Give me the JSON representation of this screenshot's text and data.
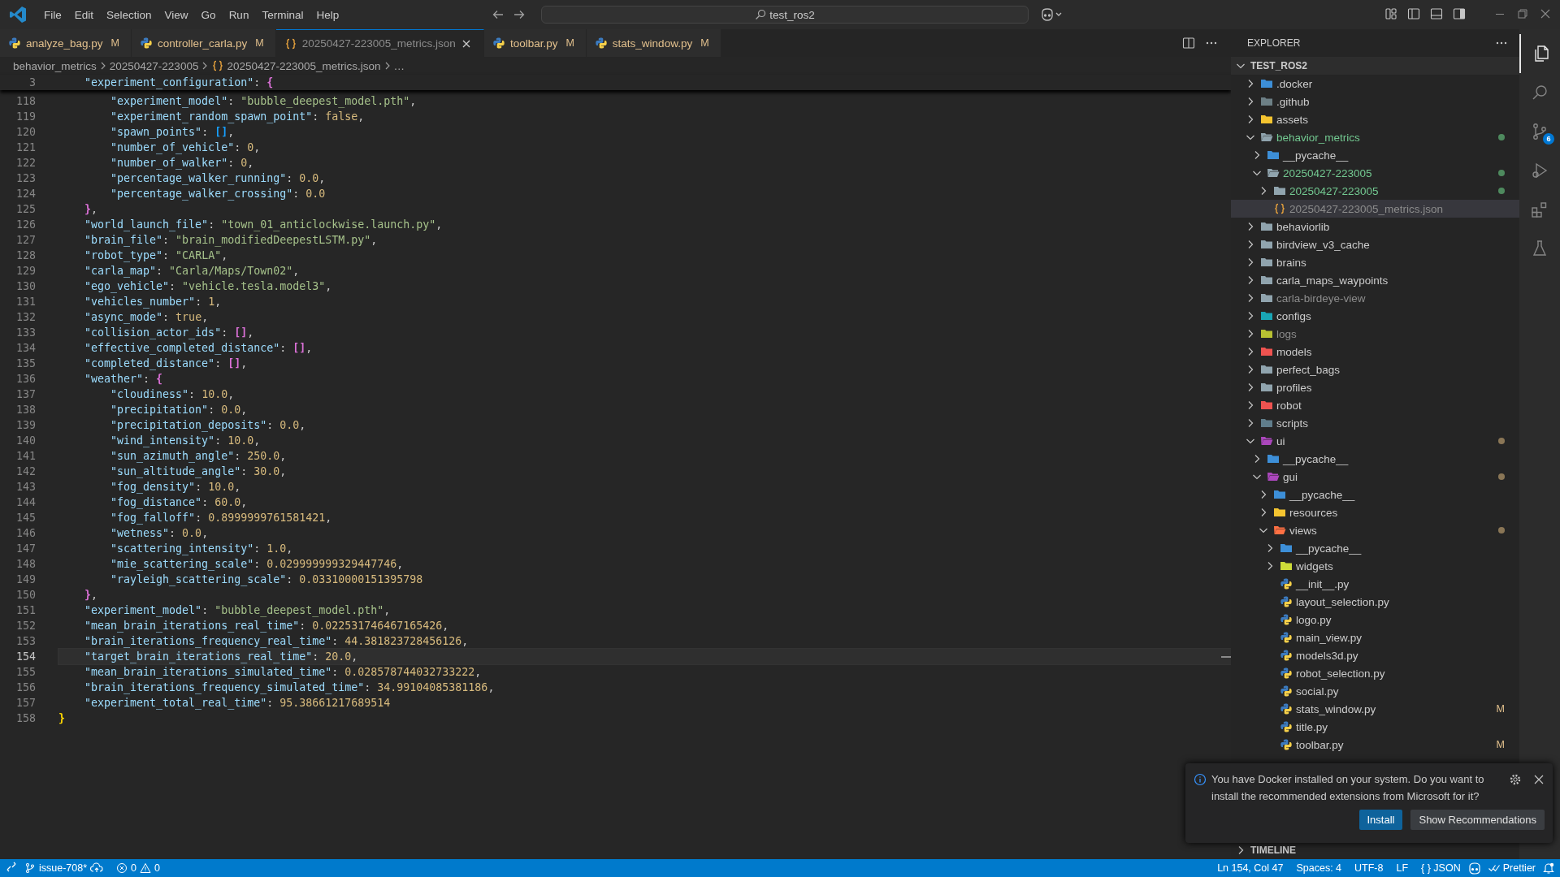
{
  "title_bar": {
    "menu": [
      "File",
      "Edit",
      "Selection",
      "View",
      "Go",
      "Run",
      "Terminal",
      "Help"
    ],
    "search": "test_ros2"
  },
  "tabs": [
    {
      "label": "analyze_bag.py",
      "kind": "python",
      "badge": "M",
      "modified": true,
      "ignored": false,
      "selected": false
    },
    {
      "label": "controller_carla.py",
      "kind": "python",
      "badge": "M",
      "modified": true,
      "ignored": false,
      "selected": false
    },
    {
      "label": "20250427-223005_metrics.json",
      "kind": "json",
      "modified": false,
      "ignored": true,
      "selected": true
    },
    {
      "label": "toolbar.py",
      "kind": "python",
      "badge": "M",
      "modified": true,
      "ignored": false,
      "selected": false
    },
    {
      "label": "stats_window.py",
      "kind": "python",
      "badge": "M",
      "modified": true,
      "ignored": false,
      "selected": false
    }
  ],
  "breadcrumbs": [
    {
      "label": "behavior_metrics",
      "kind": "folder"
    },
    {
      "label": "20250427-223005",
      "kind": "folder"
    },
    {
      "label": "20250427-223005_metrics.json",
      "kind": "json"
    },
    {
      "label": "…",
      "kind": "more"
    }
  ],
  "editor": {
    "sticky_line": {
      "number": "3",
      "tokens": [
        {
          "kind": "key",
          "text": "    \"experiment_configuration\""
        },
        {
          "kind": "punct",
          "text": ": "
        },
        {
          "kind": "bracket",
          "text": "{",
          "color": "#da70d6"
        }
      ]
    },
    "lines": [
      {
        "number": "118",
        "current": false,
        "tokens": [
          {
            "kind": "key",
            "text": "        \"experiment_model\""
          },
          {
            "kind": "punct",
            "text": ": "
          },
          {
            "kind": "string",
            "text": "\"bubble_deepest_model.pth\""
          },
          {
            "kind": "punct",
            "text": ","
          }
        ]
      },
      {
        "number": "119",
        "current": false,
        "tokens": [
          {
            "kind": "key",
            "text": "        \"experiment_random_spawn_point\""
          },
          {
            "kind": "punct",
            "text": ": "
          },
          {
            "kind": "literal",
            "text": "false"
          },
          {
            "kind": "punct",
            "text": ","
          }
        ]
      },
      {
        "number": "120",
        "current": false,
        "tokens": [
          {
            "kind": "key",
            "text": "        \"spawn_points\""
          },
          {
            "kind": "punct",
            "text": ": "
          },
          {
            "kind": "bracket",
            "text": "[]",
            "color": "#179fff"
          },
          {
            "kind": "punct",
            "text": ","
          }
        ]
      },
      {
        "number": "121",
        "current": false,
        "tokens": [
          {
            "kind": "key",
            "text": "        \"number_of_vehicle\""
          },
          {
            "kind": "punct",
            "text": ": "
          },
          {
            "kind": "number",
            "text": "0"
          },
          {
            "kind": "punct",
            "text": ","
          }
        ]
      },
      {
        "number": "122",
        "current": false,
        "tokens": [
          {
            "kind": "key",
            "text": "        \"number_of_walker\""
          },
          {
            "kind": "punct",
            "text": ": "
          },
          {
            "kind": "number",
            "text": "0"
          },
          {
            "kind": "punct",
            "text": ","
          }
        ]
      },
      {
        "number": "123",
        "current": false,
        "tokens": [
          {
            "kind": "key",
            "text": "        \"percentage_walker_running\""
          },
          {
            "kind": "punct",
            "text": ": "
          },
          {
            "kind": "number",
            "text": "0.0"
          },
          {
            "kind": "punct",
            "text": ","
          }
        ]
      },
      {
        "number": "124",
        "current": false,
        "tokens": [
          {
            "kind": "key",
            "text": "        \"percentage_walker_crossing\""
          },
          {
            "kind": "punct",
            "text": ": "
          },
          {
            "kind": "number",
            "text": "0.0"
          }
        ]
      },
      {
        "number": "125",
        "current": false,
        "tokens": [
          {
            "kind": "bracket",
            "text": "    }",
            "color": "#da70d6"
          },
          {
            "kind": "punct",
            "text": ","
          }
        ]
      },
      {
        "number": "126",
        "current": false,
        "tokens": [
          {
            "kind": "key",
            "text": "    \"world_launch_file\""
          },
          {
            "kind": "punct",
            "text": ": "
          },
          {
            "kind": "string",
            "text": "\"town_01_anticlockwise.launch.py\""
          },
          {
            "kind": "punct",
            "text": ","
          }
        ]
      },
      {
        "number": "127",
        "current": false,
        "tokens": [
          {
            "kind": "key",
            "text": "    \"brain_file\""
          },
          {
            "kind": "punct",
            "text": ": "
          },
          {
            "kind": "string",
            "text": "\"brain_modifiedDeepestLSTM.py\""
          },
          {
            "kind": "punct",
            "text": ","
          }
        ]
      },
      {
        "number": "128",
        "current": false,
        "tokens": [
          {
            "kind": "key",
            "text": "    \"robot_type\""
          },
          {
            "kind": "punct",
            "text": ": "
          },
          {
            "kind": "string",
            "text": "\"CARLA\""
          },
          {
            "kind": "punct",
            "text": ","
          }
        ]
      },
      {
        "number": "129",
        "current": false,
        "tokens": [
          {
            "kind": "key",
            "text": "    \"carla_map\""
          },
          {
            "kind": "punct",
            "text": ": "
          },
          {
            "kind": "string",
            "text": "\"Carla/Maps/Town02\""
          },
          {
            "kind": "punct",
            "text": ","
          }
        ]
      },
      {
        "number": "130",
        "current": false,
        "tokens": [
          {
            "kind": "key",
            "text": "    \"ego_vehicle\""
          },
          {
            "kind": "punct",
            "text": ": "
          },
          {
            "kind": "string",
            "text": "\"vehicle.tesla.model3\""
          },
          {
            "kind": "punct",
            "text": ","
          }
        ]
      },
      {
        "number": "131",
        "current": false,
        "tokens": [
          {
            "kind": "key",
            "text": "    \"vehicles_number\""
          },
          {
            "kind": "punct",
            "text": ": "
          },
          {
            "kind": "number",
            "text": "1"
          },
          {
            "kind": "punct",
            "text": ","
          }
        ]
      },
      {
        "number": "132",
        "current": false,
        "tokens": [
          {
            "kind": "key",
            "text": "    \"async_mode\""
          },
          {
            "kind": "punct",
            "text": ": "
          },
          {
            "kind": "literal",
            "text": "true"
          },
          {
            "kind": "punct",
            "text": ","
          }
        ]
      },
      {
        "number": "133",
        "current": false,
        "tokens": [
          {
            "kind": "key",
            "text": "    \"collision_actor_ids\""
          },
          {
            "kind": "punct",
            "text": ": "
          },
          {
            "kind": "bracket",
            "text": "[]",
            "color": "#da70d6"
          },
          {
            "kind": "punct",
            "text": ","
          }
        ]
      },
      {
        "number": "134",
        "current": false,
        "tokens": [
          {
            "kind": "key",
            "text": "    \"effective_completed_distance\""
          },
          {
            "kind": "punct",
            "text": ": "
          },
          {
            "kind": "bracket",
            "text": "[]",
            "color": "#da70d6"
          },
          {
            "kind": "punct",
            "text": ","
          }
        ]
      },
      {
        "number": "135",
        "current": false,
        "tokens": [
          {
            "kind": "key",
            "text": "    \"completed_distance\""
          },
          {
            "kind": "punct",
            "text": ": "
          },
          {
            "kind": "bracket",
            "text": "[]",
            "color": "#da70d6"
          },
          {
            "kind": "punct",
            "text": ","
          }
        ]
      },
      {
        "number": "136",
        "current": false,
        "tokens": [
          {
            "kind": "key",
            "text": "    \"weather\""
          },
          {
            "kind": "punct",
            "text": ": "
          },
          {
            "kind": "bracket",
            "text": "{",
            "color": "#da70d6"
          }
        ]
      },
      {
        "number": "137",
        "current": false,
        "tokens": [
          {
            "kind": "key",
            "text": "        \"cloudiness\""
          },
          {
            "kind": "punct",
            "text": ": "
          },
          {
            "kind": "number",
            "text": "10.0"
          },
          {
            "kind": "punct",
            "text": ","
          }
        ]
      },
      {
        "number": "138",
        "current": false,
        "tokens": [
          {
            "kind": "key",
            "text": "        \"precipitation\""
          },
          {
            "kind": "punct",
            "text": ": "
          },
          {
            "kind": "number",
            "text": "0.0"
          },
          {
            "kind": "punct",
            "text": ","
          }
        ]
      },
      {
        "number": "139",
        "current": false,
        "tokens": [
          {
            "kind": "key",
            "text": "        \"precipitation_deposits\""
          },
          {
            "kind": "punct",
            "text": ": "
          },
          {
            "kind": "number",
            "text": "0.0"
          },
          {
            "kind": "punct",
            "text": ","
          }
        ]
      },
      {
        "number": "140",
        "current": false,
        "tokens": [
          {
            "kind": "key",
            "text": "        \"wind_intensity\""
          },
          {
            "kind": "punct",
            "text": ": "
          },
          {
            "kind": "number",
            "text": "10.0"
          },
          {
            "kind": "punct",
            "text": ","
          }
        ]
      },
      {
        "number": "141",
        "current": false,
        "tokens": [
          {
            "kind": "key",
            "text": "        \"sun_azimuth_angle\""
          },
          {
            "kind": "punct",
            "text": ": "
          },
          {
            "kind": "number",
            "text": "250.0"
          },
          {
            "kind": "punct",
            "text": ","
          }
        ]
      },
      {
        "number": "142",
        "current": false,
        "tokens": [
          {
            "kind": "key",
            "text": "        \"sun_altitude_angle\""
          },
          {
            "kind": "punct",
            "text": ": "
          },
          {
            "kind": "number",
            "text": "30.0"
          },
          {
            "kind": "punct",
            "text": ","
          }
        ]
      },
      {
        "number": "143",
        "current": false,
        "tokens": [
          {
            "kind": "key",
            "text": "        \"fog_density\""
          },
          {
            "kind": "punct",
            "text": ": "
          },
          {
            "kind": "number",
            "text": "10.0"
          },
          {
            "kind": "punct",
            "text": ","
          }
        ]
      },
      {
        "number": "144",
        "current": false,
        "tokens": [
          {
            "kind": "key",
            "text": "        \"fog_distance\""
          },
          {
            "kind": "punct",
            "text": ": "
          },
          {
            "kind": "number",
            "text": "60.0"
          },
          {
            "kind": "punct",
            "text": ","
          }
        ]
      },
      {
        "number": "145",
        "current": false,
        "tokens": [
          {
            "kind": "key",
            "text": "        \"fog_falloff\""
          },
          {
            "kind": "punct",
            "text": ": "
          },
          {
            "kind": "number",
            "text": "0.8999999761581421"
          },
          {
            "kind": "punct",
            "text": ","
          }
        ]
      },
      {
        "number": "146",
        "current": false,
        "tokens": [
          {
            "kind": "key",
            "text": "        \"wetness\""
          },
          {
            "kind": "punct",
            "text": ": "
          },
          {
            "kind": "number",
            "text": "0.0"
          },
          {
            "kind": "punct",
            "text": ","
          }
        ]
      },
      {
        "number": "147",
        "current": false,
        "tokens": [
          {
            "kind": "key",
            "text": "        \"scattering_intensity\""
          },
          {
            "kind": "punct",
            "text": ": "
          },
          {
            "kind": "number",
            "text": "1.0"
          },
          {
            "kind": "punct",
            "text": ","
          }
        ]
      },
      {
        "number": "148",
        "current": false,
        "tokens": [
          {
            "kind": "key",
            "text": "        \"mie_scattering_scale\""
          },
          {
            "kind": "punct",
            "text": ": "
          },
          {
            "kind": "number",
            "text": "0.029999999329447746"
          },
          {
            "kind": "punct",
            "text": ","
          }
        ]
      },
      {
        "number": "149",
        "current": false,
        "tokens": [
          {
            "kind": "key",
            "text": "        \"rayleigh_scattering_scale\""
          },
          {
            "kind": "punct",
            "text": ": "
          },
          {
            "kind": "number",
            "text": "0.03310000151395798"
          }
        ]
      },
      {
        "number": "150",
        "current": false,
        "tokens": [
          {
            "kind": "bracket",
            "text": "    }",
            "color": "#da70d6"
          },
          {
            "kind": "punct",
            "text": ","
          }
        ]
      },
      {
        "number": "151",
        "current": false,
        "tokens": [
          {
            "kind": "key",
            "text": "    \"experiment_model\""
          },
          {
            "kind": "punct",
            "text": ": "
          },
          {
            "kind": "string",
            "text": "\"bubble_deepest_model.pth\""
          },
          {
            "kind": "punct",
            "text": ","
          }
        ]
      },
      {
        "number": "152",
        "current": false,
        "tokens": [
          {
            "kind": "key",
            "text": "    \"mean_brain_iterations_real_time\""
          },
          {
            "kind": "punct",
            "text": ": "
          },
          {
            "kind": "number",
            "text": "0.022531746467165426"
          },
          {
            "kind": "punct",
            "text": ","
          }
        ]
      },
      {
        "number": "153",
        "current": false,
        "tokens": [
          {
            "kind": "key",
            "text": "    \"brain_iterations_frequency_real_time\""
          },
          {
            "kind": "punct",
            "text": ": "
          },
          {
            "kind": "number",
            "text": "44.381823728456126"
          },
          {
            "kind": "punct",
            "text": ","
          }
        ]
      },
      {
        "number": "154",
        "current": true,
        "tokens": [
          {
            "kind": "key",
            "text": "    \"target_brain_iterations_real_time\""
          },
          {
            "kind": "punct",
            "text": ": "
          },
          {
            "kind": "number",
            "text": "20.0"
          },
          {
            "kind": "punct",
            "text": ","
          }
        ]
      },
      {
        "number": "155",
        "current": false,
        "tokens": [
          {
            "kind": "key",
            "text": "    \"mean_brain_iterations_simulated_time\""
          },
          {
            "kind": "punct",
            "text": ": "
          },
          {
            "kind": "number",
            "text": "0.028578744032733222"
          },
          {
            "kind": "punct",
            "text": ","
          }
        ]
      },
      {
        "number": "156",
        "current": false,
        "tokens": [
          {
            "kind": "key",
            "text": "    \"brain_iterations_frequency_simulated_time\""
          },
          {
            "kind": "punct",
            "text": ": "
          },
          {
            "kind": "number",
            "text": "34.99104085381186"
          },
          {
            "kind": "punct",
            "text": ","
          }
        ]
      },
      {
        "number": "157",
        "current": false,
        "tokens": [
          {
            "kind": "key",
            "text": "    \"experiment_total_real_time\""
          },
          {
            "kind": "punct",
            "text": ": "
          },
          {
            "kind": "number",
            "text": "95.38661217689514"
          }
        ]
      },
      {
        "number": "158",
        "current": false,
        "tokens": [
          {
            "kind": "bracket",
            "text": "}",
            "color": "#ffd700"
          }
        ]
      }
    ]
  },
  "explorer": {
    "title": "EXPLORER",
    "root": {
      "label": "TEST_ROS2",
      "expanded": true
    },
    "tree": [
      {
        "label": ".docker",
        "kind": "folder",
        "color": "#3d8fd8",
        "expanded": false,
        "selected": false,
        "added": false,
        "ignored": false,
        "modified": false
      },
      {
        "label": ".github",
        "kind": "folder",
        "color": "#6d8086",
        "expanded": false,
        "selected": false,
        "added": false,
        "ignored": false,
        "modified": false
      },
      {
        "label": "assets",
        "kind": "folder",
        "color": "#f4c430",
        "expanded": false,
        "selected": false,
        "added": false,
        "ignored": false,
        "modified": false
      },
      {
        "label": "behavior_metrics",
        "kind": "folder",
        "color": "#90a4ae",
        "expanded": true,
        "selected": false,
        "added": true,
        "ignored": false,
        "modified": false,
        "children": [
          {
            "label": "__pycache__",
            "kind": "folder",
            "color": "#3d8fd8",
            "expanded": false,
            "selected": false,
            "added": false,
            "ignored": false,
            "modified": false
          },
          {
            "label": "20250427-223005",
            "kind": "folder",
            "color": "#90a4ae",
            "expanded": true,
            "selected": false,
            "added": true,
            "ignored": false,
            "modified": false,
            "children": [
              {
                "label": "20250427-223005",
                "kind": "folder",
                "color": "#90a4ae",
                "expanded": false,
                "selected": false,
                "added": true,
                "ignored": false,
                "modified": false
              },
              {
                "label": "20250427-223005_metrics.json",
                "kind": "json",
                "selected": true,
                "added": false,
                "ignored": true,
                "modified": false
              }
            ]
          }
        ]
      },
      {
        "label": "behaviorlib",
        "kind": "folder",
        "color": "#90a4ae",
        "expanded": false,
        "selected": false,
        "added": false,
        "ignored": false,
        "modified": false
      },
      {
        "label": "birdview_v3_cache",
        "kind": "folder",
        "color": "#90a4ae",
        "expanded": false,
        "selected": false,
        "added": false,
        "ignored": false,
        "modified": false
      },
      {
        "label": "brains",
        "kind": "folder",
        "color": "#90a4ae",
        "expanded": false,
        "selected": false,
        "added": false,
        "ignored": false,
        "modified": false
      },
      {
        "label": "carla_maps_waypoints",
        "kind": "folder",
        "color": "#90a4ae",
        "expanded": false,
        "selected": false,
        "added": false,
        "ignored": false,
        "modified": false
      },
      {
        "label": "carla-birdeye-view",
        "kind": "folder",
        "color": "#90a4ae",
        "expanded": false,
        "selected": false,
        "added": false,
        "ignored": true,
        "modified": false
      },
      {
        "label": "configs",
        "kind": "folder",
        "color": "#19a5b5",
        "expanded": false,
        "selected": false,
        "added": false,
        "ignored": false,
        "modified": false
      },
      {
        "label": "logs",
        "kind": "folder",
        "color": "#b8c132",
        "expanded": false,
        "selected": false,
        "added": false,
        "ignored": true,
        "modified": false
      },
      {
        "label": "models",
        "kind": "folder",
        "color": "#ef5350",
        "expanded": false,
        "selected": false,
        "added": false,
        "ignored": false,
        "modified": false
      },
      {
        "label": "perfect_bags",
        "kind": "folder",
        "color": "#90a4ae",
        "expanded": false,
        "selected": false,
        "added": false,
        "ignored": false,
        "modified": false
      },
      {
        "label": "profiles",
        "kind": "folder",
        "color": "#90a4ae",
        "expanded": false,
        "selected": false,
        "added": false,
        "ignored": false,
        "modified": false
      },
      {
        "label": "robot",
        "kind": "folder",
        "color": "#ef5350",
        "expanded": false,
        "selected": false,
        "added": false,
        "ignored": false,
        "modified": false
      },
      {
        "label": "scripts",
        "kind": "folder",
        "color": "#607d8b",
        "expanded": false,
        "selected": false,
        "added": false,
        "ignored": false,
        "modified": false
      },
      {
        "label": "ui",
        "kind": "folder",
        "color": "#ab47bc",
        "expanded": true,
        "selected": false,
        "added": false,
        "ignored": false,
        "modified": true,
        "children": [
          {
            "label": "__pycache__",
            "kind": "folder",
            "color": "#3d8fd8",
            "expanded": false,
            "selected": false,
            "added": false,
            "ignored": false,
            "modified": false
          },
          {
            "label": "gui",
            "kind": "folder",
            "color": "#ab47bc",
            "expanded": true,
            "selected": false,
            "added": false,
            "ignored": false,
            "modified": true,
            "children": [
              {
                "label": "__pycache__",
                "kind": "folder",
                "color": "#3d8fd8",
                "expanded": false,
                "selected": false,
                "added": false,
                "ignored": false,
                "modified": false
              },
              {
                "label": "resources",
                "kind": "folder",
                "color": "#f4c430",
                "expanded": false,
                "selected": false,
                "added": false,
                "ignored": false,
                "modified": false
              },
              {
                "label": "views",
                "kind": "folder",
                "color": "#ff7043",
                "expanded": true,
                "selected": false,
                "added": false,
                "ignored": false,
                "modified": true,
                "children": [
                  {
                    "label": "__pycache__",
                    "kind": "folder",
                    "color": "#3d8fd8",
                    "expanded": false,
                    "selected": false,
                    "added": false,
                    "ignored": false,
                    "modified": false
                  },
                  {
                    "label": "widgets",
                    "kind": "folder",
                    "color": "#cddc39",
                    "expanded": false,
                    "selected": false,
                    "added": false,
                    "ignored": false,
                    "modified": false
                  },
                  {
                    "label": "__init__.py",
                    "kind": "python",
                    "selected": false,
                    "added": false,
                    "ignored": false,
                    "modified": false
                  },
                  {
                    "label": "layout_selection.py",
                    "kind": "python",
                    "selected": false,
                    "added": false,
                    "ignored": false,
                    "modified": false
                  },
                  {
                    "label": "logo.py",
                    "kind": "python",
                    "selected": false,
                    "added": false,
                    "ignored": false,
                    "modified": false
                  },
                  {
                    "label": "main_view.py",
                    "kind": "python",
                    "selected": false,
                    "added": false,
                    "ignored": false,
                    "modified": false
                  },
                  {
                    "label": "models3d.py",
                    "kind": "python",
                    "selected": false,
                    "added": false,
                    "ignored": false,
                    "modified": false
                  },
                  {
                    "label": "robot_selection.py",
                    "kind": "python",
                    "selected": false,
                    "added": false,
                    "ignored": false,
                    "modified": false
                  },
                  {
                    "label": "social.py",
                    "kind": "python",
                    "selected": false,
                    "added": false,
                    "ignored": false,
                    "modified": false
                  },
                  {
                    "label": "stats_window.py",
                    "kind": "python",
                    "selected": false,
                    "added": false,
                    "ignored": false,
                    "modified": true,
                    "badge": "M"
                  },
                  {
                    "label": "title.py",
                    "kind": "python",
                    "selected": false,
                    "added": false,
                    "ignored": false,
                    "modified": false
                  },
                  {
                    "label": "toolbar.py",
                    "kind": "python",
                    "selected": false,
                    "added": false,
                    "ignored": false,
                    "modified": true,
                    "badge": "M"
                  }
                ]
              }
            ]
          }
        ]
      }
    ],
    "timeline": {
      "label": "TIMELINE",
      "expanded": false
    }
  },
  "activity_bar": [
    {
      "kind": "explorer",
      "selected": true
    },
    {
      "kind": "search",
      "selected": false
    },
    {
      "kind": "source-control",
      "selected": false,
      "badge": "6"
    },
    {
      "kind": "run-debug",
      "selected": false
    },
    {
      "kind": "extensions",
      "selected": false
    },
    {
      "kind": "testing",
      "selected": false
    }
  ],
  "notification": {
    "message": "You have Docker installed on your system. Do you want to install the recommended extensions from Microsoft for it?",
    "buttons": [
      {
        "label": "Install",
        "primary": true
      },
      {
        "label": "Show Recommendations",
        "primary": false
      }
    ]
  },
  "status_bar": {
    "branch": "issue-708*",
    "errors": "0",
    "warnings": "0",
    "position": "Ln 154, Col 47",
    "indentation": "Spaces: 4",
    "encoding": "UTF-8",
    "eol": "LF",
    "language_icon": "{ }",
    "language": "JSON",
    "formatter": "Prettier"
  }
}
